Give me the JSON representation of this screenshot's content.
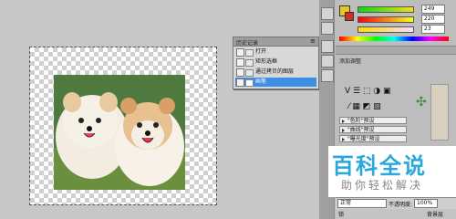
{
  "colors": {
    "accent": "#3c8fe6",
    "swatch_fg": "#e6c821",
    "swatch_bg": "#d03020",
    "watermark": "#2aa7dd"
  },
  "color_panel": {
    "values": [
      "249",
      "220",
      "23"
    ]
  },
  "history_panel": {
    "title": "历史记录",
    "items": [
      {
        "label": "打开",
        "selected": false
      },
      {
        "label": "矩形选框",
        "selected": false
      },
      {
        "label": "通过拷贝的图层",
        "selected": false
      },
      {
        "label": "画笔",
        "selected": true
      }
    ]
  },
  "adjustments": {
    "title": "添加调整"
  },
  "styles_panel": {
    "rows": [
      "\"色阶\"预设",
      "\"曲线\"预设",
      "\"曝光度\"预设",
      "\"色相/饱和度\"预设"
    ]
  },
  "layers": {
    "blend_mode": "正常",
    "opacity_label": "不透明度:",
    "opacity_value": "100%"
  },
  "bottom_bar": {
    "lock_label": "锁",
    "fill_value": "背景层"
  },
  "watermark": {
    "main": "百科全说",
    "sub": "助你轻松解决"
  }
}
